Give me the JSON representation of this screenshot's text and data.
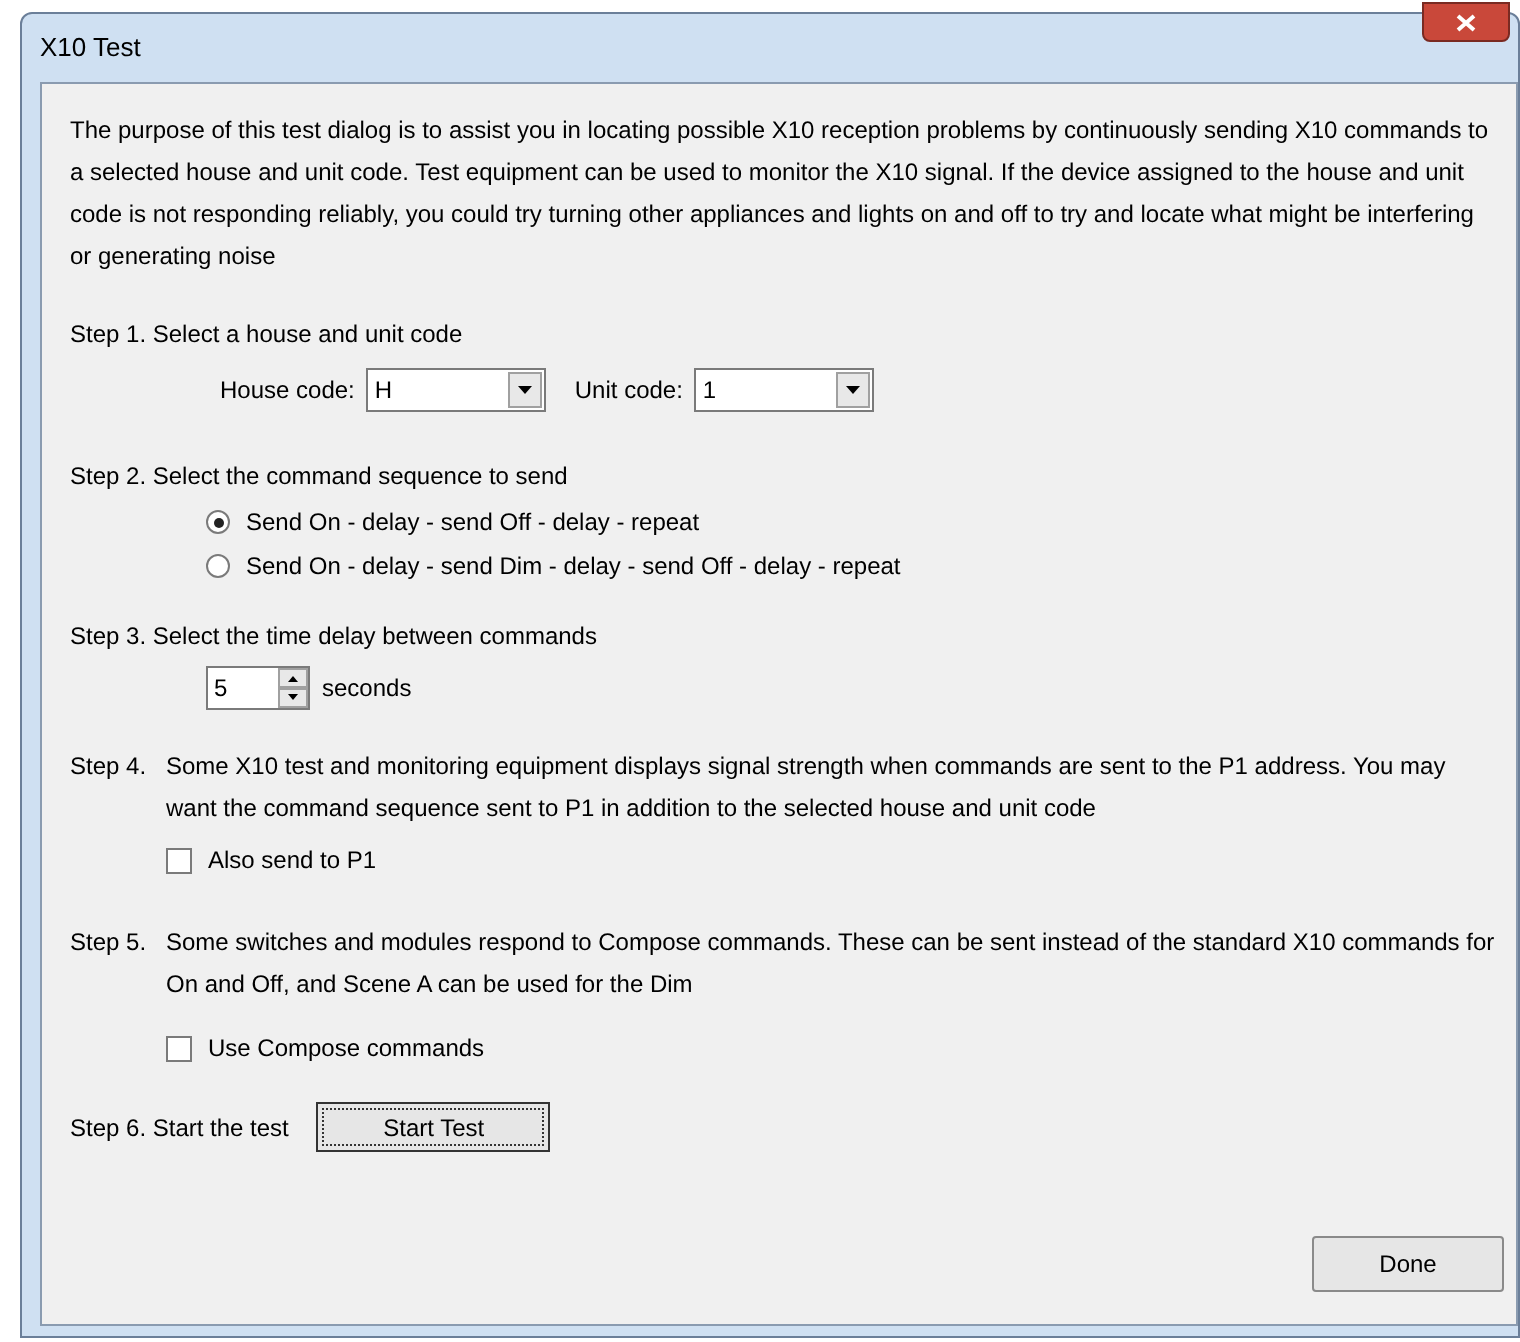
{
  "window": {
    "title": "X10 Test"
  },
  "intro": "The purpose of this test dialog is to assist you in locating possible X10 reception problems by continuously sending X10 commands to a selected house and unit code.  Test equipment can be used to monitor the X10 signal.  If the device assigned to the house and unit code is not responding reliably, you could try turning other appliances and lights on and off to try and locate what might be interfering or generating noise",
  "step1": {
    "label": "Step 1. Select a house and unit code",
    "house_code": {
      "label": "House code:",
      "value": "H"
    },
    "unit_code": {
      "label": "Unit code:",
      "value": "1"
    }
  },
  "step2": {
    "label": "Step 2. Select the command sequence to send",
    "options": [
      {
        "label": "Send On - delay - send Off - delay - repeat",
        "selected": true
      },
      {
        "label": "Send On - delay - send Dim - delay - send Off - delay - repeat",
        "selected": false
      }
    ]
  },
  "step3": {
    "label": "Step 3. Select the time delay between commands",
    "value": "5",
    "unit": "seconds"
  },
  "step4": {
    "label": "Step 4.",
    "text": "Some X10 test and monitoring equipment displays signal strength when commands are sent to the P1 address.  You may want the command sequence sent to P1 in addition to the selected house and unit code",
    "checkbox": {
      "label": "Also send to P1",
      "checked": false
    }
  },
  "step5": {
    "label": "Step 5.",
    "text": "Some switches and modules respond to Compose commands.  These can be sent instead of the standard X10 commands for On and Off, and Scene A can be used for the Dim",
    "checkbox": {
      "label": "Use Compose commands",
      "checked": false
    }
  },
  "step6": {
    "label": "Step 6. Start the test",
    "button": "Start Test"
  },
  "buttons": [
    "Done"
  ]
}
